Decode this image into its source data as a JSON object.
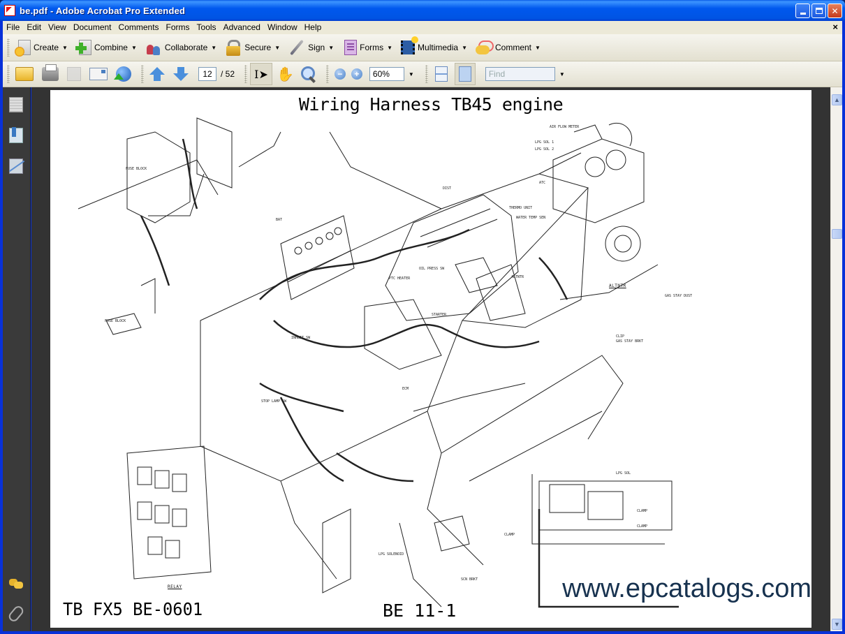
{
  "window": {
    "title": "be.pdf - Adobe Acrobat Pro Extended",
    "controls": [
      "minimize",
      "maximize",
      "close"
    ]
  },
  "menubar": {
    "items": [
      "File",
      "Edit",
      "View",
      "Document",
      "Comments",
      "Forms",
      "Tools",
      "Advanced",
      "Window",
      "Help"
    ],
    "close_glyph": "×"
  },
  "tasks_toolbar": {
    "buttons": [
      {
        "label": "Create",
        "icon": "create-pdf-icon"
      },
      {
        "label": "Combine",
        "icon": "combine-icon"
      },
      {
        "label": "Collaborate",
        "icon": "collaborate-icon"
      },
      {
        "label": "Secure",
        "icon": "lock-icon"
      },
      {
        "label": "Sign",
        "icon": "pen-icon"
      },
      {
        "label": "Forms",
        "icon": "forms-icon"
      },
      {
        "label": "Multimedia",
        "icon": "multimedia-icon"
      },
      {
        "label": "Comment",
        "icon": "comment-icon"
      }
    ],
    "dropdown_glyph": "▼"
  },
  "nav_toolbar": {
    "current_page": "12",
    "total_pages": "/ 52",
    "zoom_level": "60%",
    "find_placeholder": "Find",
    "zoom_out_glyph": "−",
    "zoom_in_glyph": "+",
    "select_glyph": "I",
    "hand_glyph": "✋"
  },
  "scrollbar": {
    "up_glyph": "▲",
    "down_glyph": "▼",
    "position_fraction": 0.24
  },
  "document": {
    "title": "Wiring Harness TB45 engine",
    "code": "TB FX5 BE-0601",
    "page_label": "BE 11-1",
    "watermark": "www.epcatalogs.com",
    "diagram_labels": [
      "AIR FLOW METER",
      "LPG SOL 1",
      "LPG SOL 2",
      "ATC",
      "THERMO UNIT",
      "WATER TEMP SEN",
      "BAT",
      "FUSE BLOCK",
      "FUSE BLOCK",
      "OIL PRESS SW",
      "PTC HEATER",
      "ALTNTR",
      "ALTNTR",
      "GAS STAY DUST",
      "CLIP",
      "GAS STAY BRKT",
      "STOP LAMP SW",
      "INHBIT SW",
      "LPG SOL",
      "CLAMP",
      "CLAMP",
      "CLAMP",
      "RELAY",
      "DIST",
      "STARTER",
      "ECM",
      "LPG SOLENOID",
      "SCN BRKT"
    ]
  }
}
